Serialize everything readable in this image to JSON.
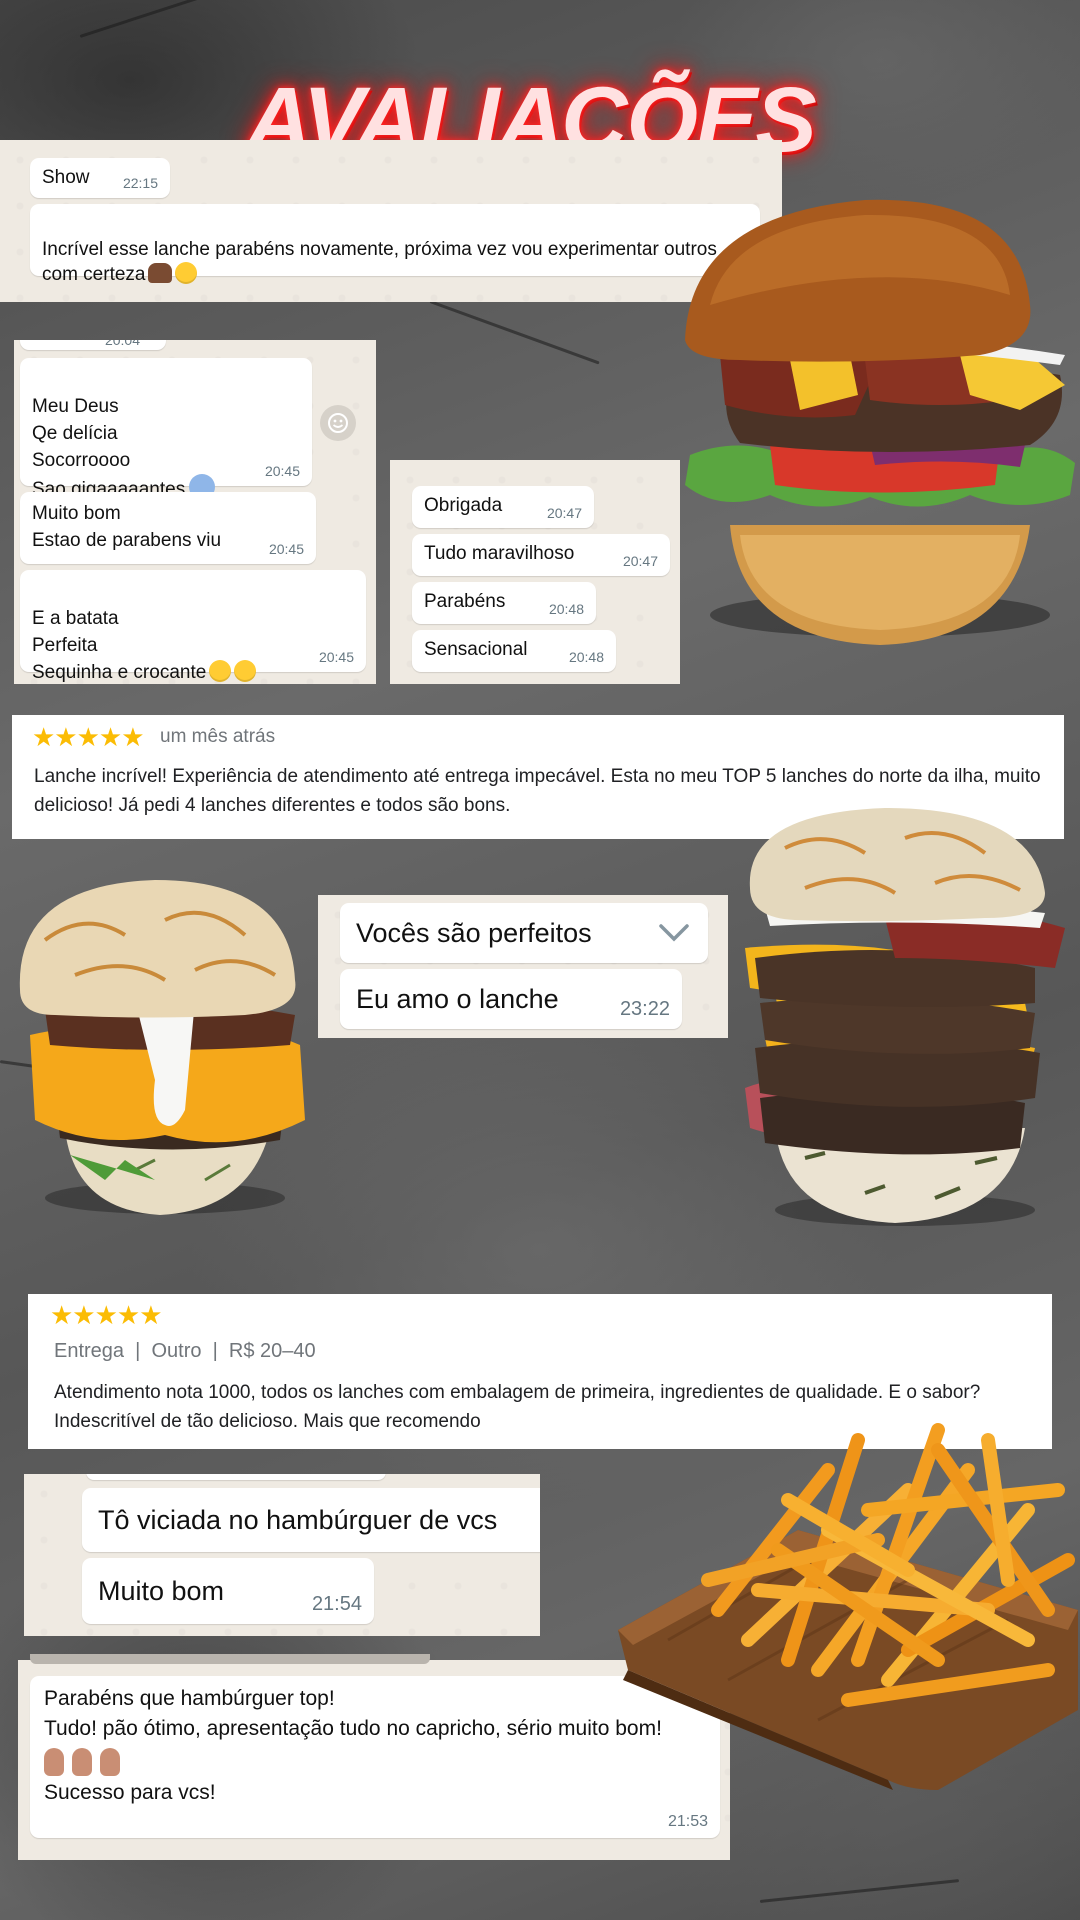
{
  "title": "AVALIAÇÕES",
  "chat1": [
    {
      "text": "Show",
      "time": "22:15"
    },
    {
      "text": "Incrível esse lanche parabéns novamente, próxima vez vou experimentar outros com certeza",
      "time": ""
    }
  ],
  "chat2": {
    "cut_time": "20:04",
    "messages": [
      {
        "text": "Meu Deus\nQe delícia\nSocorroooo\nSao gigaaaaantes",
        "time": "20:45"
      },
      {
        "text": "Muito bom\nEstao de parabens viu",
        "time": "20:45"
      },
      {
        "text": "E a batata\nPerfeita\nSequinha e crocante",
        "time": "20:45"
      }
    ]
  },
  "chat3": [
    {
      "text": "Obrigada",
      "time": "20:47"
    },
    {
      "text": "Tudo maravilhoso",
      "time": "20:47"
    },
    {
      "text": "Parabéns",
      "time": "20:48"
    },
    {
      "text": "Sensacional",
      "time": "20:48"
    }
  ],
  "review1": {
    "stars": "★★★★★",
    "when": "um mês atrás",
    "text": "Lanche incrível! Experiência de atendimento até entrega impecável. Esta no meu TOP 5 lanches do norte da ilha, muito delicioso! Já pedi 4 lanches diferentes e todos são bons."
  },
  "chat4": [
    {
      "text": "Vocês são perfeitos",
      "time": ""
    },
    {
      "text": "Eu amo o lanche",
      "time": "23:22"
    }
  ],
  "review2": {
    "stars": "★★★★★",
    "meta": "Entrega  |  Outro  |  R$ 20–40",
    "text": "Atendimento nota 1000, todos os lanches com embalagem de primeira, ingredientes de qualidade. E o sabor? Indescritível de tão delicioso. Mais que recomendo"
  },
  "chat5": [
    {
      "text": "Tô viciada no hambúrguer de vcs",
      "time": ""
    },
    {
      "text": "Muito bom",
      "time": "21:54"
    }
  ],
  "chat6": {
    "text_top": "Parabéns que hambúrguer top!\nTudo! pão ótimo, apresentação tudo no capricho, sério muito bom!",
    "text_bottom": "Sucesso para vcs!",
    "time": "21:53"
  },
  "colors": {
    "title_glow": "#ff2020",
    "chat_bg": "#efeae2",
    "star": "#fbbc04",
    "timestamp": "#667781"
  },
  "icons": [
    "smiley-icon",
    "chevron-down-icon"
  ]
}
